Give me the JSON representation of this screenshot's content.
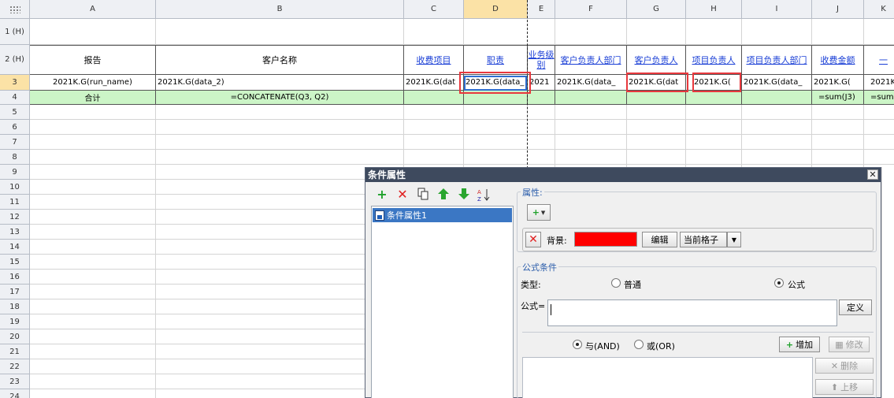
{
  "columns": [
    "A",
    "B",
    "C",
    "D",
    "E",
    "F",
    "G",
    "H",
    "I",
    "J",
    "K"
  ],
  "rows": [
    "1 (H)",
    "2 (H)",
    "3",
    "4",
    "5",
    "6",
    "7",
    "8",
    "9",
    "10",
    "11",
    "12",
    "13",
    "14",
    "15",
    "16",
    "17",
    "18",
    "19",
    "20",
    "21",
    "22",
    "23",
    "24"
  ],
  "row2": {
    "a": "报告",
    "b": "客户名称",
    "c": "收费项目",
    "d": "职责",
    "e": "业务级别",
    "f": "客户负责人部门",
    "g": "客户负责人",
    "h": "项目负责人",
    "i": "项目负责人部门",
    "j": "收费金额",
    "k": "一"
  },
  "row3": {
    "a": "2021K.G(run_name)",
    "b": "2021K.G(data_2)",
    "c": "2021K.G(dat",
    "d": "2021K.G(data_",
    "e": "2021",
    "f": "2021K.G(data_",
    "g": "2021K.G(dat",
    "h": "2021K.G(",
    "i": "2021K.G(data_",
    "j": "2021K.G(",
    "k": "2021K"
  },
  "row4": {
    "a": "合计",
    "b": "=CONCATENATE(Q3, Q2)",
    "j": "=sum(J3)",
    "k": "=sum("
  },
  "dialog": {
    "title": "条件属性",
    "close": "✕",
    "list_item": "条件属性1",
    "props_label": "属性:",
    "bg_label": "背景:",
    "bg_color": "#ff0000",
    "edit_btn": "编辑",
    "scope": "当前格子",
    "formula_group": "公式条件",
    "type_label": "类型:",
    "type_normal": "普通",
    "type_formula": "公式",
    "formula_label": "公式=",
    "define_btn": "定义",
    "and_label": "与(AND)",
    "or_label": "或(OR)",
    "add_btn": "增加",
    "modify_btn": "修改",
    "delete_btn": "删除",
    "up_btn": "上移"
  }
}
